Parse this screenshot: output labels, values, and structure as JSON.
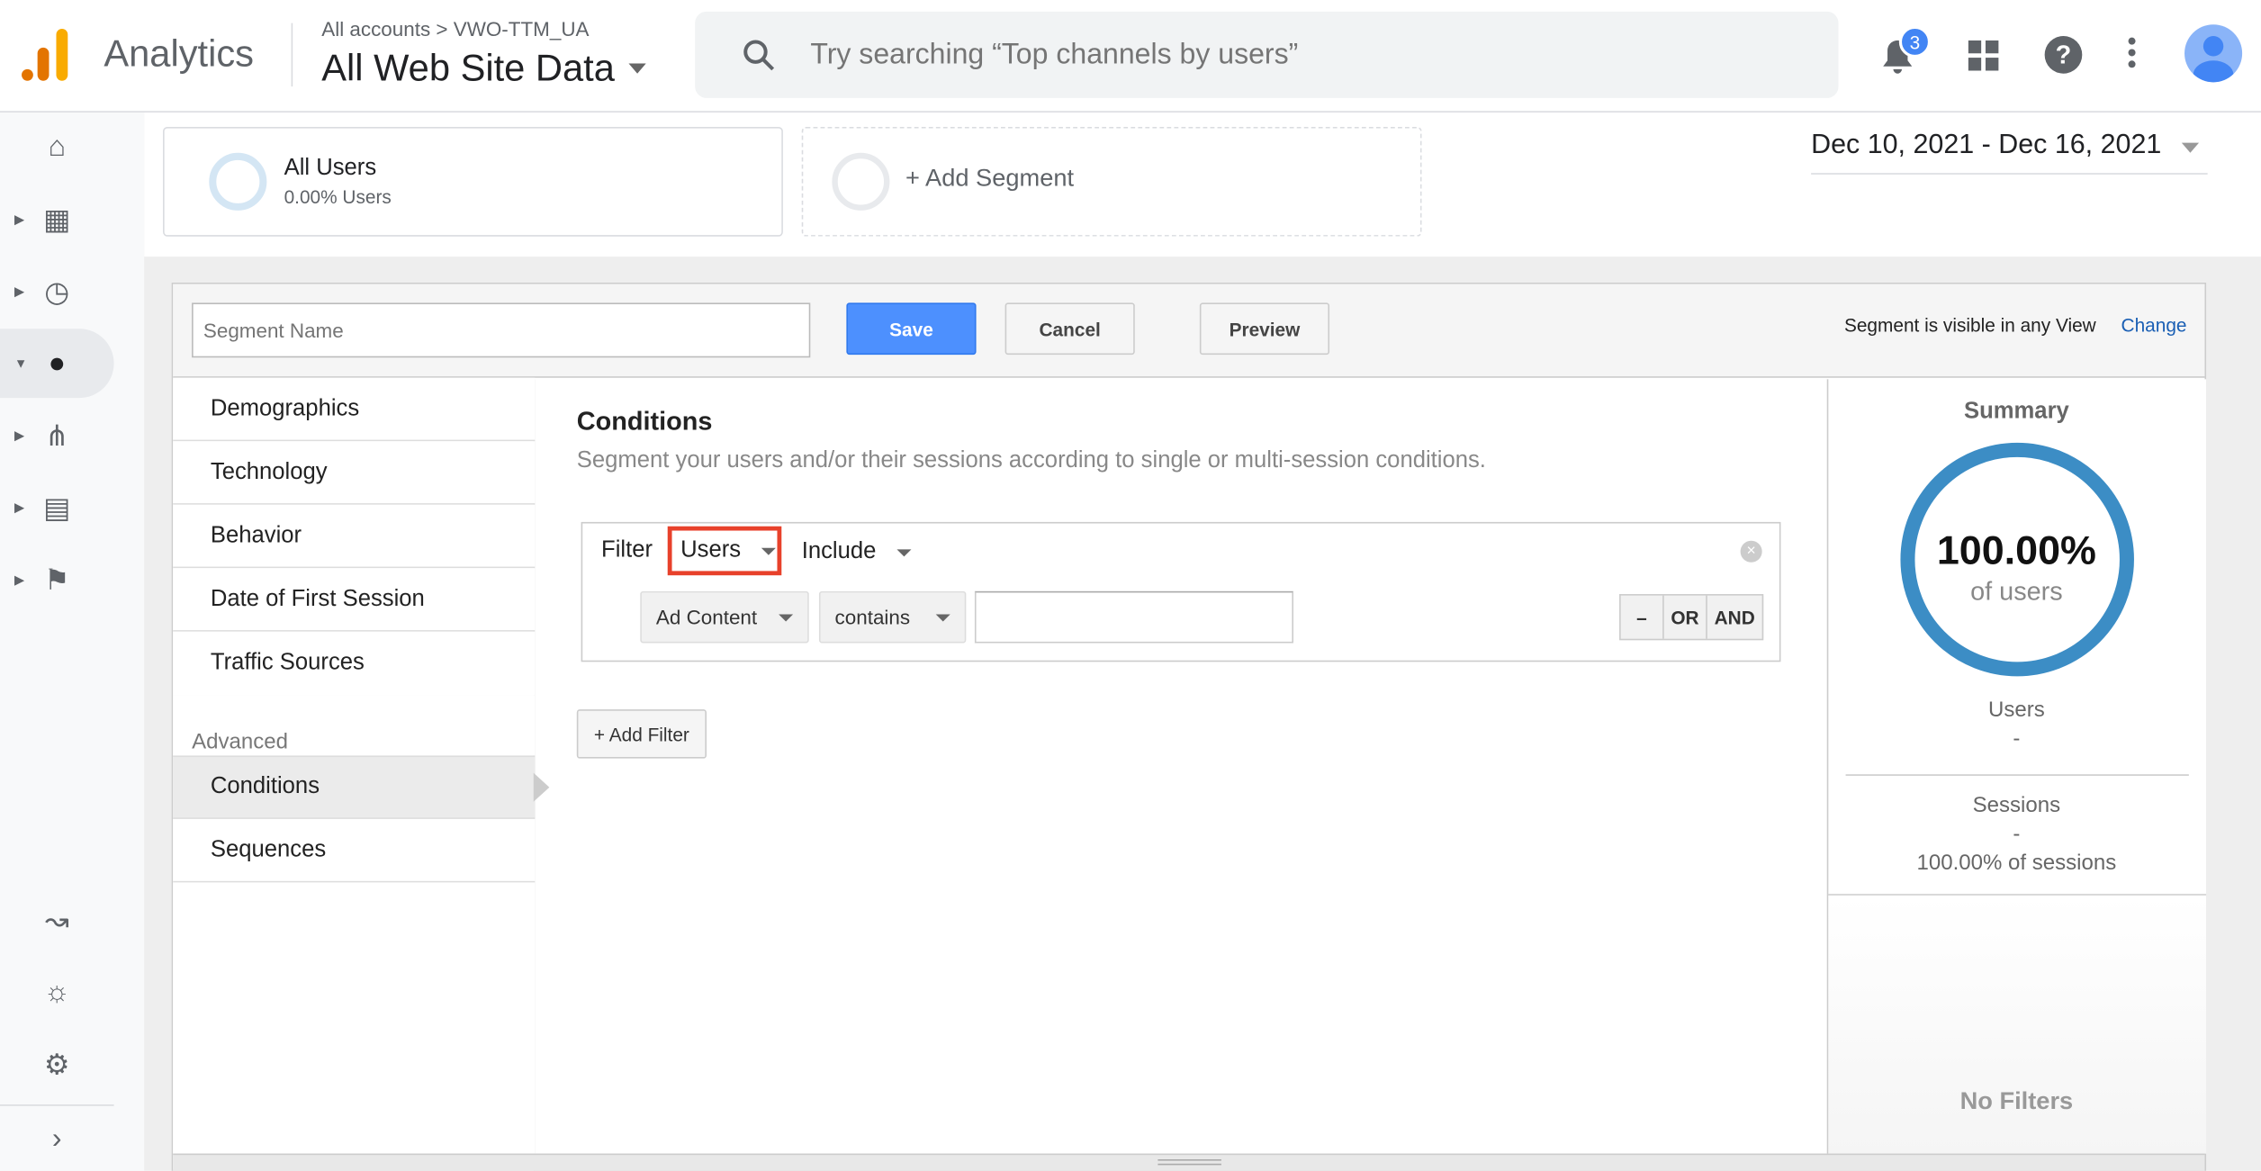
{
  "header": {
    "app": "Analytics",
    "breadcrumb": "All accounts > VWO-TTM_UA",
    "property": "All Web Site Data",
    "search_placeholder": "Try searching “Top channels by users”",
    "notifications": "3"
  },
  "segments": {
    "current_name": "All Users",
    "current_value": "0.00% Users",
    "add": "+ Add Segment"
  },
  "date_range": "Dec 10, 2021 - Dec 16, 2021",
  "editor": {
    "name_placeholder": "Segment Name",
    "save": "Save",
    "cancel": "Cancel",
    "preview": "Preview",
    "visibility": "Segment is visible in any View",
    "change": "Change"
  },
  "nav": {
    "items": [
      "Demographics",
      "Technology",
      "Behavior",
      "Date of First Session",
      "Traffic Sources"
    ],
    "advanced_label": "Advanced",
    "advanced": [
      "Conditions",
      "Sequences"
    ],
    "active": "Conditions"
  },
  "conditions": {
    "title": "Conditions",
    "subtitle": "Segment your users and/or their sessions according to single or multi-session conditions.",
    "filter_label": "Filter",
    "scope": "Users",
    "mode": "Include",
    "dimension": "Ad Content",
    "operator": "contains",
    "value": "",
    "minus": "–",
    "or": "OR",
    "and": "AND",
    "add_filter": "+ Add Filter"
  },
  "summary": {
    "title": "Summary",
    "percent": "100.00%",
    "of_users": "of users",
    "users_label": "Users",
    "users_value": "-",
    "sessions_label": "Sessions",
    "sessions_value": "-",
    "sessions_pct": "100.00% of sessions",
    "no_filters": "No Filters",
    "fill_percent": 100
  },
  "colors": {
    "accent": "#4d90fe",
    "ring": "#3c8dc5",
    "highlight": "#e8412b"
  }
}
